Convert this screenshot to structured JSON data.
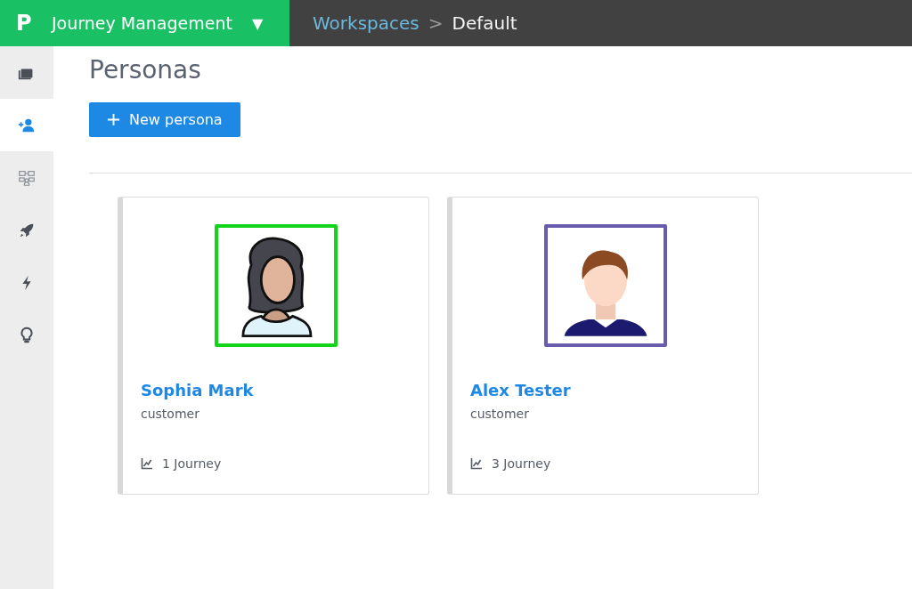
{
  "app_bar": {
    "logo": "P",
    "title": "Journey Management",
    "caret": "▼"
  },
  "breadcrumb": {
    "items": [
      "Workspaces",
      "Default"
    ],
    "separator": ">"
  },
  "sidebar": {
    "items": [
      {
        "selected": false
      },
      {
        "selected": true
      },
      {
        "selected": false
      },
      {
        "selected": false
      },
      {
        "selected": false
      },
      {
        "selected": false
      }
    ]
  },
  "page": {
    "title": "Personas",
    "new_button": "New persona"
  },
  "personas": [
    {
      "name": "Sophia Mark",
      "role": "customer",
      "journeys": "1 Journey",
      "color": "#11d41b"
    },
    {
      "name": "Alex Tester",
      "role": "customer",
      "journeys": "3 Journey",
      "color": "#6a5cad"
    }
  ]
}
